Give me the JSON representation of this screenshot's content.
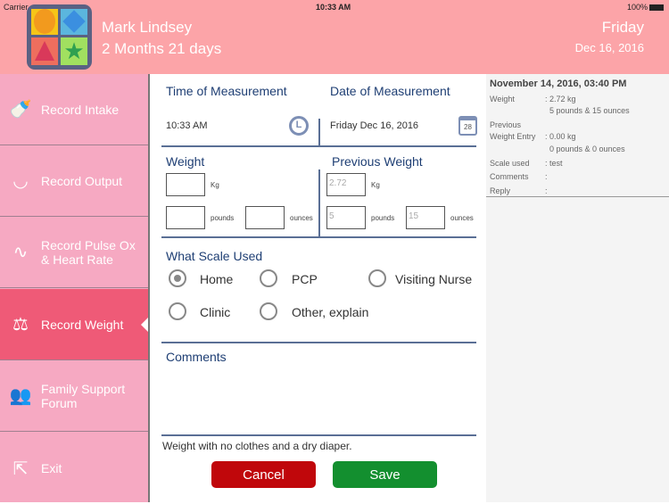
{
  "status_bar": {
    "carrier": "Carrier",
    "time": "10:33 AM",
    "battery": "100%"
  },
  "header": {
    "name": "Mark Lindsey",
    "age": "2 Months 21 days",
    "day": "Friday",
    "date": "Dec 16, 2016"
  },
  "sidebar": {
    "items": [
      {
        "label": "Record Intake",
        "icon": "bottle-icon"
      },
      {
        "label": "Record Output",
        "icon": "diaper-icon"
      },
      {
        "label": "Record Pulse Ox\n& Heart Rate",
        "icon": "pulse-icon"
      },
      {
        "label": "Record Weight",
        "icon": "scale-icon"
      },
      {
        "label": "Family Support\nForum",
        "icon": "people-icon"
      },
      {
        "label": "Exit",
        "icon": "exit-icon"
      }
    ]
  },
  "form": {
    "time_label": "Time of Measurement",
    "time_value": "10:33 AM",
    "date_label": "Date of Measurement",
    "date_value": "Friday Dec 16, 2016",
    "calendar_day": "28",
    "weight_label": "Weight",
    "prev_weight_label": "Previous Weight",
    "kg": "Kg",
    "pounds": "pounds",
    "ounces": "ounces",
    "prev_kg": "2.72",
    "prev_pounds": "5",
    "prev_ounces": "15",
    "scale_label": "What Scale Used",
    "scale_options": [
      "Home",
      "PCP",
      "Visiting Nurse",
      "Clinic",
      "Other, explain"
    ],
    "selected_scale": "Home",
    "comments_label": "Comments",
    "comment_hint": "Weight with no clothes and a dry diaper.",
    "cancel": "Cancel",
    "save": "Save"
  },
  "history": {
    "title": "November 14, 2016, 03:40 PM",
    "weight_label": "Weight",
    "weight_kg": ": 2.72 kg",
    "weight_lb": "5 pounds & 15 ounces",
    "prev_label1": "Previous",
    "prev_label2": "Weight Entry",
    "prev_kg": ": 0.00 kg",
    "prev_lb": "0 pounds & 0 ounces",
    "scale_label": "Scale used",
    "scale_value": ": test",
    "comments_label": "Comments",
    "comments_value": ":",
    "reply_label": "Reply",
    "reply_value": ":"
  },
  "colors": {
    "header": "#fca4a8",
    "sidebar": "#f6a9c2",
    "active": "#ef5a77",
    "heading": "#1f3f74",
    "cancel": "#c0070b",
    "save": "#138f2f"
  }
}
